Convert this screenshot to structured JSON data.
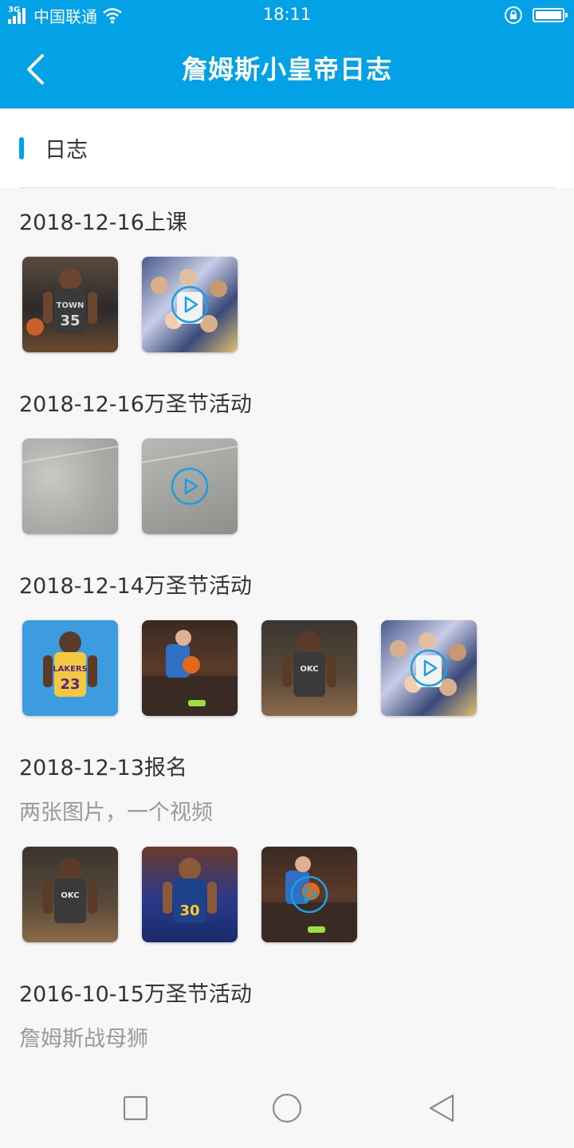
{
  "status_bar": {
    "network_type": "3G",
    "carrier": "中国联通",
    "time": "18:11",
    "battery_level": 1.0
  },
  "header": {
    "title": "詹姆斯小皇帝日志",
    "back_icon": "chevron-left-icon"
  },
  "section": {
    "title": "日志"
  },
  "entries": [
    {
      "title": "2018-12-16上课",
      "media": [
        {
          "kind": "image",
          "subject": "player-kd"
        },
        {
          "kind": "video",
          "subject": "crowd"
        }
      ]
    },
    {
      "title": "2018-12-16万圣节活动",
      "media": [
        {
          "kind": "image",
          "subject": "concrete"
        },
        {
          "kind": "video",
          "subject": "concrete"
        }
      ]
    },
    {
      "title": "2018-12-14万圣节活动",
      "media": [
        {
          "kind": "image",
          "subject": "player-lebron"
        },
        {
          "kind": "image",
          "subject": "bench"
        },
        {
          "kind": "image",
          "subject": "player-okc"
        },
        {
          "kind": "video",
          "subject": "crowd"
        }
      ]
    },
    {
      "title": "2018-12-13报名",
      "description": "两张图片，一个视频",
      "media": [
        {
          "kind": "image",
          "subject": "player-okc"
        },
        {
          "kind": "image",
          "subject": "player-curry"
        },
        {
          "kind": "video",
          "subject": "bench"
        }
      ]
    },
    {
      "title": "2016-10-15万圣节活动",
      "description": "詹姆斯战母狮"
    }
  ],
  "nav": {
    "recents_icon": "square-icon",
    "home_icon": "circle-icon",
    "back_icon": "triangle-back-icon"
  },
  "colors": {
    "primary": "#03a2e6",
    "background": "#f7f7f7",
    "text": "#333333",
    "secondary_text": "#9a9a9a",
    "play_icon": "#1aa0e0"
  }
}
